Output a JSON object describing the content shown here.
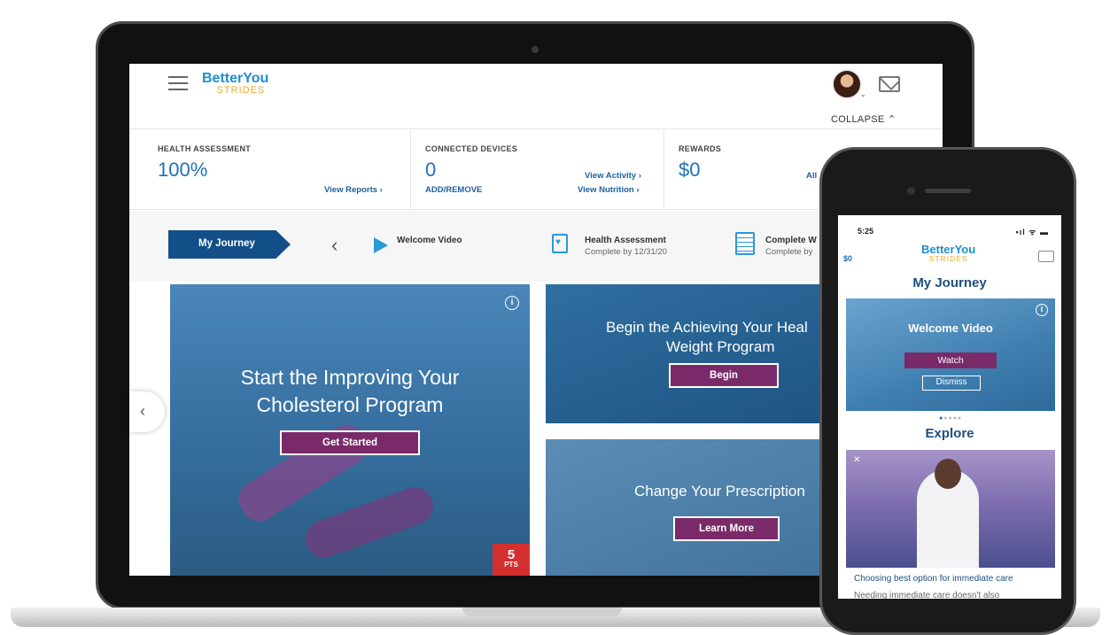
{
  "brand": {
    "name": "BetterYou",
    "tagline": "STRIDES",
    "accent": "#1f8fd1",
    "secondary": "#f2a92c",
    "button_color": "#7a2a69"
  },
  "desktop": {
    "header": {
      "collapse_label": "COLLAPSE",
      "collapse_icon": "chevron-up-icon"
    },
    "stats": [
      {
        "label": "HEALTH ASSESSMENT",
        "value": "100%",
        "link": "View Reports"
      },
      {
        "label": "CONNECTED DEVICES",
        "value": "0",
        "link": "ADD/REMOVE",
        "links": [
          "View Activity",
          "View Nutrition"
        ]
      },
      {
        "label": "REWARDS",
        "value": "$0",
        "link": "All"
      }
    ],
    "journey": {
      "tab_label": "My Journey",
      "steps": [
        {
          "title": "Welcome Video",
          "subtitle": "",
          "icon": "play-icon"
        },
        {
          "title": "Health Assessment",
          "subtitle": "Complete by 12/31/20",
          "icon": "clipboard-heart-icon"
        },
        {
          "title": "Complete W",
          "subtitle": "Complete by",
          "icon": "checklist-icon"
        }
      ]
    },
    "cards": [
      {
        "title_line1": "Start the Improving Your",
        "title_line2": "Cholesterol Program",
        "button": "Get Started",
        "points": "5",
        "points_label": "PTS"
      },
      {
        "title_line1": "Begin the Achieving Your Heal",
        "title_line2": "Weight Program",
        "button": "Begin"
      },
      {
        "title_line1": "Change Your Prescription",
        "button": "Learn More"
      }
    ]
  },
  "mobile": {
    "status": {
      "time": "5:25",
      "signal": "•ıl ᯤ ▬"
    },
    "balance": "$0",
    "journey_title": "My Journey",
    "video_card": {
      "title": "Welcome Video",
      "watch": "Watch",
      "dismiss": "Dismiss"
    },
    "explore_title": "Explore",
    "explore_card": {
      "caption": "Choosing best option for immediate care",
      "snippet": "Needing immediate care doesn't also"
    }
  }
}
